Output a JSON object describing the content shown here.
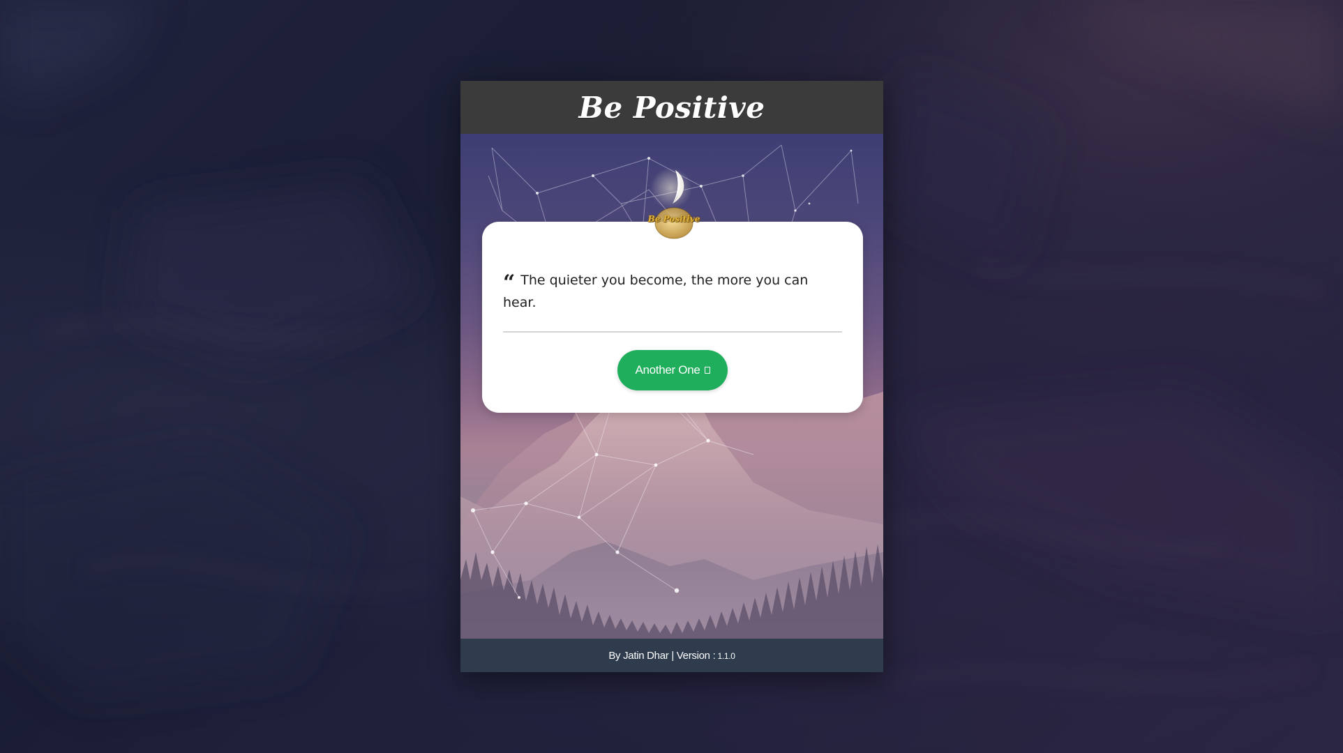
{
  "app": {
    "title": "Be Positive",
    "logo_text": "Be Positive"
  },
  "quote": {
    "text": "The quieter you become, the more you can hear.",
    "icon": "quote-left-icon"
  },
  "button": {
    "label": "Another One",
    "icon": "unknown-glyph-box-icon",
    "color": "#1fae5b"
  },
  "footer": {
    "author_text": "By Jatin Dhar | Version :",
    "version": "1.1.0"
  },
  "colors": {
    "header_bg": "#3b3b3b",
    "footer_bg": "#2e3c4e",
    "page_bg": "#1c1f35",
    "card_bg": "#ffffff"
  }
}
